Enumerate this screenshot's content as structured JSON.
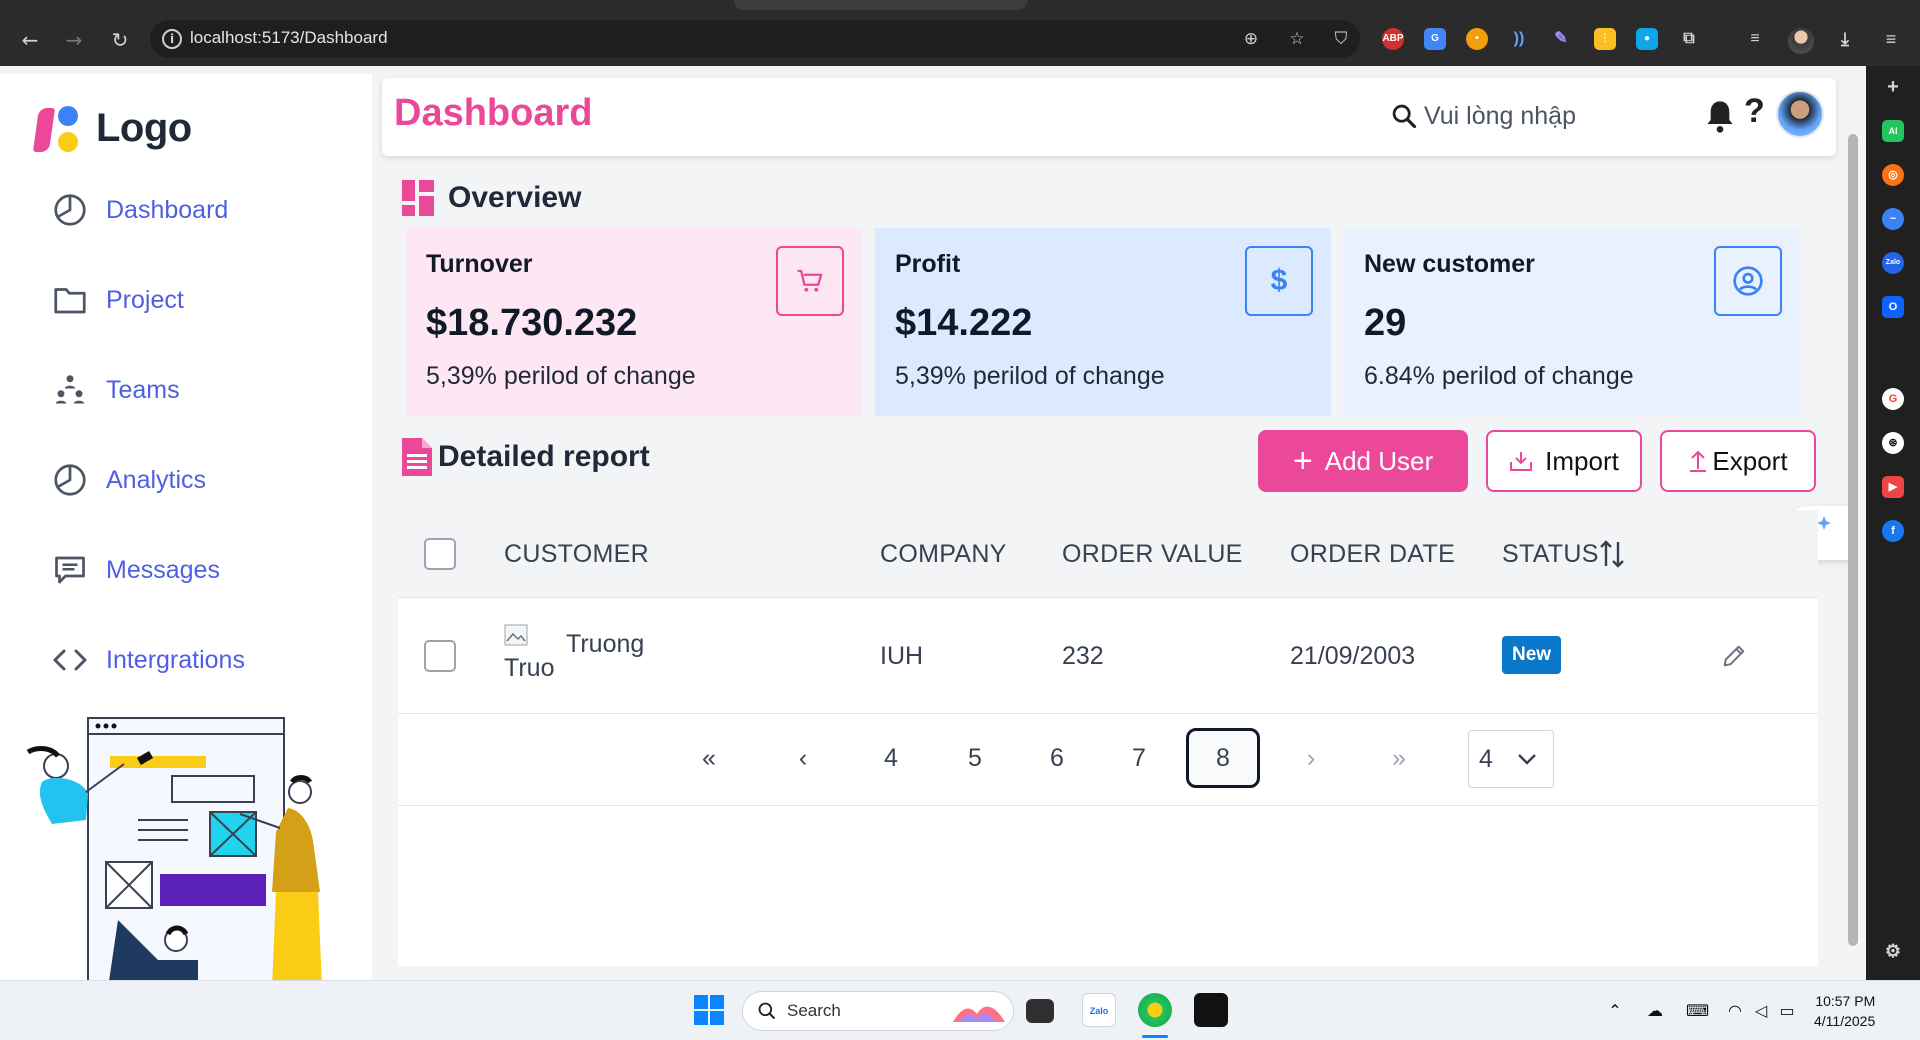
{
  "browser": {
    "url": "localhost:5173/Dashboard"
  },
  "sidebar": {
    "logo_text": "Logo",
    "items": [
      {
        "label": "Dashboard",
        "icon": "pie-chart-icon"
      },
      {
        "label": "Project",
        "icon": "folder-icon"
      },
      {
        "label": "Teams",
        "icon": "team-icon"
      },
      {
        "label": "Analytics",
        "icon": "pie-chart-icon"
      },
      {
        "label": "Messages",
        "icon": "message-icon"
      },
      {
        "label": "Intergrations",
        "icon": "code-icon"
      }
    ]
  },
  "header": {
    "title": "Dashboard",
    "search_placeholder": "Vui lòng nhập",
    "help_label": "?"
  },
  "overview": {
    "title": "Overview",
    "cards": [
      {
        "title": "Turnover",
        "value": "$18.730.232",
        "change": "5,39% perilod of change",
        "icon": "cart-icon",
        "bg": "#fce7f3",
        "accent": "#ec4899"
      },
      {
        "title": "Profit",
        "value": "$14.222",
        "change": "5,39% perilod of change",
        "icon": "dollar-icon",
        "bg": "#dbeafe",
        "accent": "#3b82f6"
      },
      {
        "title": "New customer",
        "value": "29",
        "change": "6.84% perilod of change",
        "icon": "user-circle-icon",
        "bg": "#e8f1fd",
        "accent": "#3b82f6"
      }
    ]
  },
  "report": {
    "title": "Detailed report",
    "add_label": "Add User",
    "import_label": "Import",
    "export_label": "Export",
    "columns": [
      "CUSTOMER",
      "COMPANY",
      "ORDER VALUE",
      "ORDER DATE",
      "STATUS"
    ],
    "rows": [
      {
        "avatar_alt": "Truo",
        "customer": "Truong",
        "company": "IUH",
        "order_value": "232",
        "order_date": "21/09/2003",
        "status": "New"
      }
    ],
    "pagination": {
      "first": "«",
      "prev": "‹",
      "pages": [
        "4",
        "5",
        "6",
        "7",
        "8"
      ],
      "current": "8",
      "next": "›",
      "last": "»",
      "page_size": "4"
    }
  },
  "taskbar": {
    "search_label": "Search",
    "time": "10:57 PM",
    "date": "4/11/2025"
  },
  "colors": {
    "brand_pink": "#ec4899",
    "nav_blue": "#4f5fe5",
    "status_blue": "#0b77c9"
  }
}
